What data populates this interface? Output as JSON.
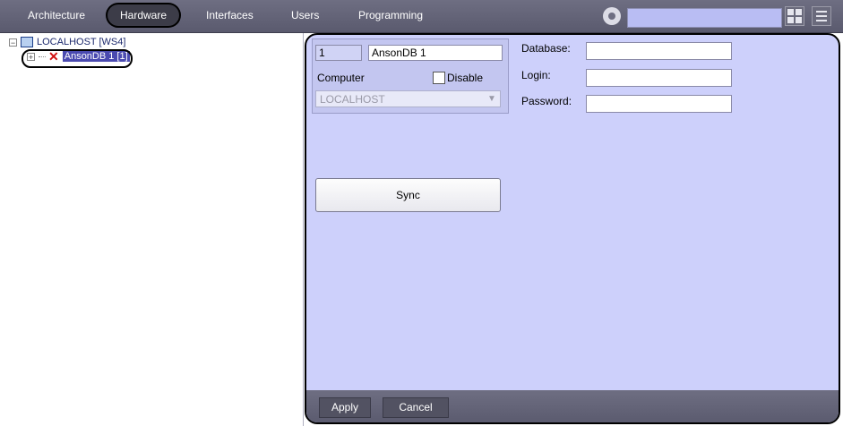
{
  "topbar": {
    "tabs": [
      {
        "label": "Architecture"
      },
      {
        "label": "Hardware"
      },
      {
        "label": "Interfaces"
      },
      {
        "label": "Users"
      },
      {
        "label": "Programming"
      }
    ],
    "active_tab": "Hardware",
    "search_value": ""
  },
  "tree": {
    "root_label": "LOCALHOST [WS4]",
    "child_label": "AnsonDB 1 [1]"
  },
  "settings": {
    "id_value": "1",
    "name_value": "AnsonDB 1",
    "computer_label": "Computer",
    "disable_label": "Disable",
    "disable_checked": false,
    "computer_value": "LOCALHOST",
    "database_label": "Database:",
    "database_value": "",
    "login_label": "Login:",
    "login_value": "",
    "password_label": "Password:",
    "password_value": "",
    "sync_label": "Sync"
  },
  "footer": {
    "apply_label": "Apply",
    "cancel_label": "Cancel"
  },
  "colors": {
    "panel_bg": "#cdd0fb",
    "topbar_bg": "#6e6e82",
    "error_icon": "#d21212"
  },
  "icons": [
    "settings-gear-icon",
    "layout-grid-icon",
    "menu-list-icon",
    "computer-icon",
    "error-x-icon",
    "expand-icon",
    "collapse-icon",
    "chevron-down-icon"
  ]
}
